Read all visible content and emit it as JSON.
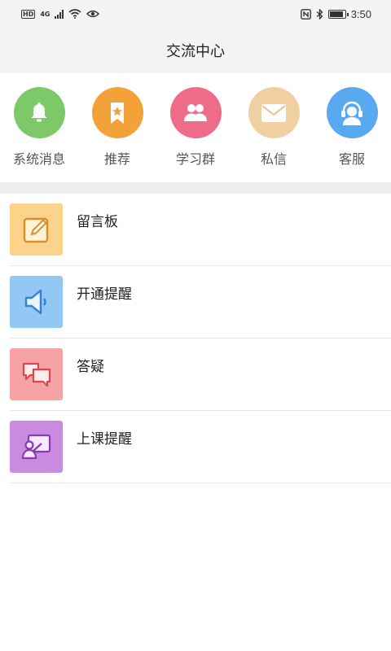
{
  "status_bar": {
    "hd": "HD",
    "network": "4G",
    "time": "3:50",
    "battery_level": 0.8
  },
  "header": {
    "title": "交流中心"
  },
  "entries": [
    {
      "label": "系统消息",
      "icon": "bell-icon",
      "color": "#7cc96a"
    },
    {
      "label": "推荐",
      "icon": "bookmark-star-icon",
      "color": "#f3a23a"
    },
    {
      "label": "学习群",
      "icon": "group-icon",
      "color": "#ee6c87"
    },
    {
      "label": "私信",
      "icon": "mail-icon",
      "color": "#f0cfa0"
    },
    {
      "label": "客服",
      "icon": "headset-icon",
      "color": "#58a9f0"
    }
  ],
  "list": [
    {
      "label": "留言板",
      "icon": "edit-note-icon",
      "color": "#fbd38a"
    },
    {
      "label": "开通提醒",
      "icon": "speaker-icon",
      "color": "#93c8f5"
    },
    {
      "label": "答疑",
      "icon": "chat-bubbles-icon",
      "color": "#f6a3a5"
    },
    {
      "label": "上课提醒",
      "icon": "teacher-board-icon",
      "color": "#c88be0"
    }
  ]
}
